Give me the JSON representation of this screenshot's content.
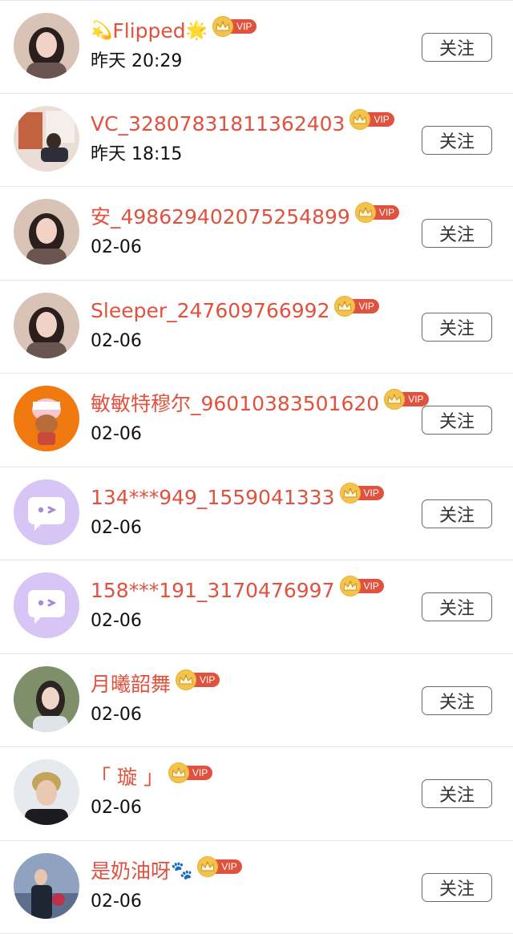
{
  "follow_label": "关注",
  "vip_label": "VIP",
  "colors": {
    "name": "#e0523e",
    "vip_badge": "#e0523e",
    "crown": "#f3c34c",
    "divider": "#e6e6e6"
  },
  "rows": [
    {
      "name": "Flipped",
      "prefix_emoji": "💫",
      "suffix_emoji": "🌟",
      "time": "昨天 20:29",
      "avatar": "photo-girl"
    },
    {
      "name": "VC_32807831811362403",
      "prefix_emoji": "",
      "suffix_emoji": "",
      "time": "昨天 18:15",
      "avatar": "photo-room"
    },
    {
      "name": "安_498629402075254899",
      "prefix_emoji": "",
      "suffix_emoji": "",
      "time": "02-06",
      "avatar": "photo-girl"
    },
    {
      "name": "Sleeper_247609766992",
      "prefix_emoji": "",
      "suffix_emoji": "",
      "time": "02-06",
      "avatar": "photo-girl"
    },
    {
      "name": "敏敏特穆尔_96010383501620",
      "prefix_emoji": "",
      "suffix_emoji": "",
      "time": "02-06",
      "avatar": "cartoon-orange"
    },
    {
      "name": "134***949_1559041333",
      "prefix_emoji": "",
      "suffix_emoji": "",
      "time": "02-06",
      "avatar": "default-chat"
    },
    {
      "name": "158***191_3170476997",
      "prefix_emoji": "",
      "suffix_emoji": "",
      "time": "02-06",
      "avatar": "default-chat"
    },
    {
      "name": "月曦韶舞",
      "prefix_emoji": "",
      "suffix_emoji": "",
      "time": "02-06",
      "avatar": "photo-green"
    },
    {
      "name": "「 璇 」",
      "prefix_emoji": "",
      "suffix_emoji": "",
      "time": "02-06",
      "avatar": "photo-man"
    },
    {
      "name": "是奶油呀",
      "prefix_emoji": "",
      "suffix_emoji": "🐾",
      "time": "02-06",
      "avatar": "photo-suit"
    }
  ]
}
